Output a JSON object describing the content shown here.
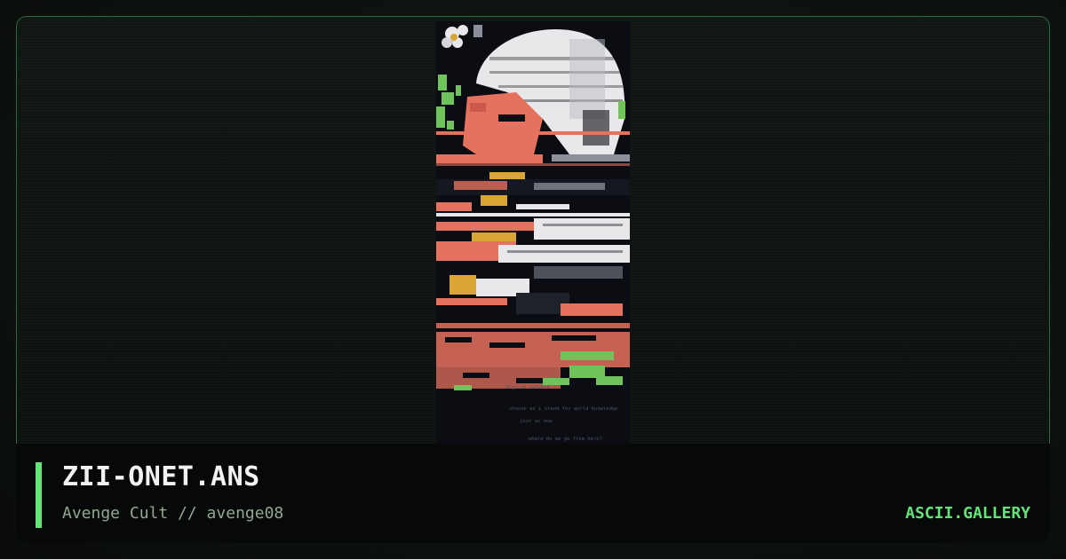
{
  "artwork": {
    "filename": "ZII-ONET.ANS",
    "credit": "Avenge Cult // avenge08",
    "art_text": {
      "line1": "elysium   network",
      "line2": "choose as i  stand for world knowledge",
      "line3": "join us now",
      "line4": "where do we go from here?"
    }
  },
  "brand": {
    "name": "ASCII.GALLERY"
  },
  "colors": {
    "accent": "#62e576",
    "border": "#2f6b3a",
    "title": "#f1f3f1",
    "subtitle": "#8fa88f",
    "art_salmon": "#e5715f",
    "art_white": "#e8e8ea",
    "art_gold": "#d9a534",
    "art_green": "#6fc35a",
    "art_gray": "#8a8f99"
  }
}
